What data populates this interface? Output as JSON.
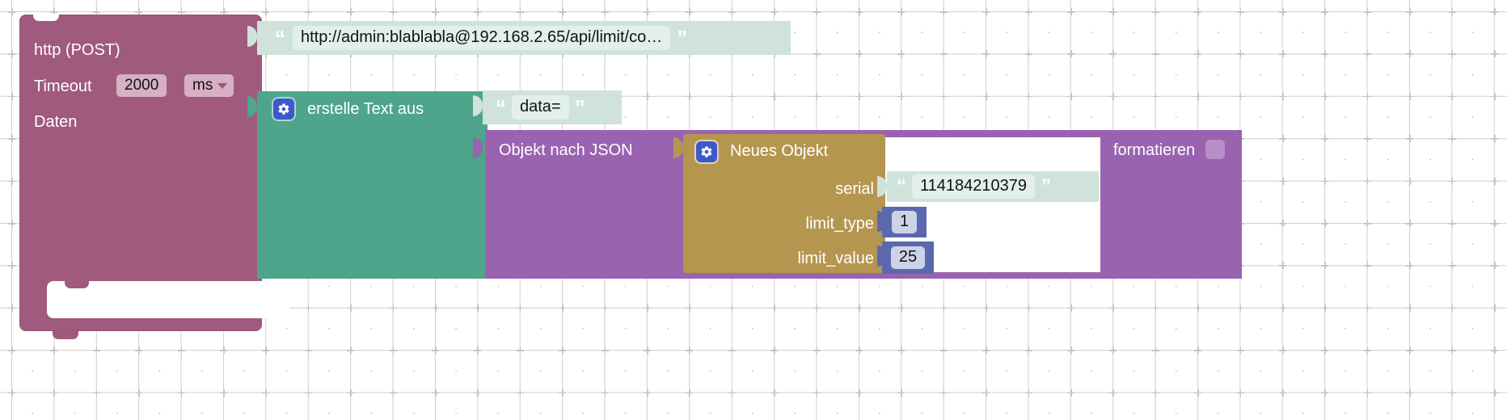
{
  "workspace": {
    "type": "blockly-visual-program",
    "language": "de",
    "background_color": "#ffffff",
    "grid_dot_color": "#c6c6c6"
  },
  "blocks": {
    "http": {
      "name": "http-post-block",
      "title": "http (POST)",
      "color": "#a05a7e",
      "fields": [
        {
          "label": "Timeout",
          "value": "2000",
          "unit": "ms",
          "unit_is_dropdown": true
        },
        {
          "label": "Daten",
          "value": "",
          "unit": "",
          "unit_is_dropdown": false
        }
      ],
      "timeout_label": "Timeout",
      "timeout_value": "2000",
      "timeout_unit": "ms",
      "daten_label": "Daten"
    },
    "url_string": {
      "name": "url-text-block",
      "color": "#cfe3db",
      "value": "http://admin:blablabla@192.168.2.65/api/limit/co…",
      "open_quote": "“",
      "close_quote": "”"
    },
    "join_text": {
      "name": "create-text-block",
      "label": "erstelle Text aus",
      "color": "#4fa58c",
      "icon": "gear-icon"
    },
    "data_string": {
      "name": "data-prefix-text-block",
      "color": "#cfe3db",
      "value": "data=",
      "open_quote": "“",
      "close_quote": "”"
    },
    "object_to_json": {
      "name": "object-to-json-block",
      "label": "Objekt nach JSON",
      "color": "#9a63b0",
      "format_label": "formatieren",
      "format_checked": false
    },
    "new_object": {
      "name": "new-object-block",
      "label": "Neues Objekt",
      "color": "#b5964f",
      "icon": "gear-icon",
      "properties": [
        {
          "key": "serial",
          "value": "114184210379",
          "value_type": "string"
        },
        {
          "key": "limit_type",
          "value": "1",
          "value_type": "number"
        },
        {
          "key": "limit_value",
          "value": "25",
          "value_type": "number"
        }
      ]
    }
  }
}
